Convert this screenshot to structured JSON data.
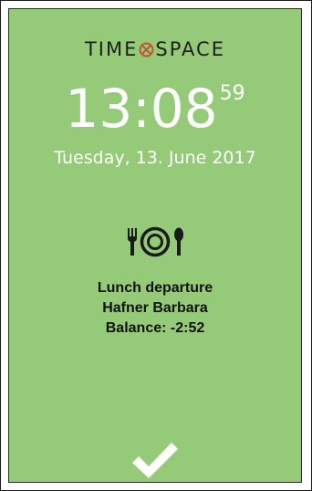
{
  "logo": {
    "left_text": "TIME",
    "right_text": "SPACE",
    "mark_icon": "clock-cross-icon",
    "mark_color": "#c94a2e"
  },
  "clock": {
    "hours_minutes": "13:08",
    "seconds": "59"
  },
  "date": "Tuesday, 13. June 2017",
  "event": {
    "icon": "cutlery-plate-icon",
    "type": "Lunch departure",
    "employee": "Hafner Barbara",
    "balance": "Balance: -2:52"
  },
  "confirmation": {
    "icon": "checkmark-icon"
  },
  "colors": {
    "panel_background": "#95cb78",
    "text_light": "#ffffff",
    "text_dark": "#111111"
  }
}
